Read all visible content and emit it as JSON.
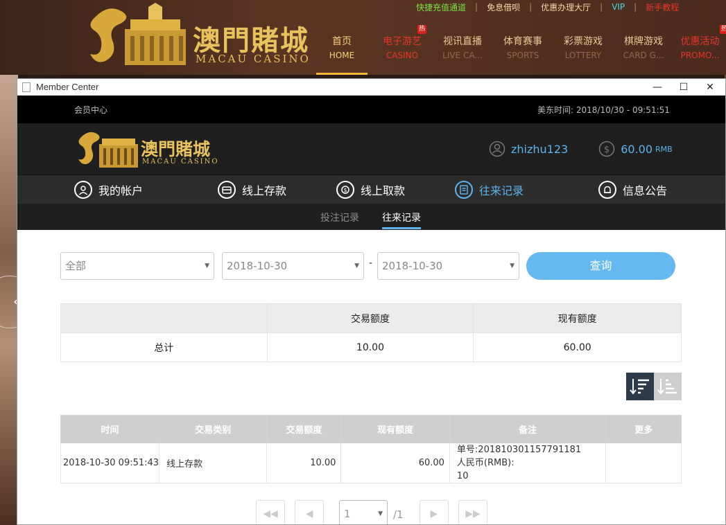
{
  "site": {
    "logo_cn": "澳門賭城",
    "logo_en": "MACAU CASINO",
    "top_links": [
      "快捷充值通道",
      "免息借呗",
      "优惠办理大厅",
      "VIP",
      "新手教程"
    ],
    "top_link_colors": [
      "#7de04a",
      "#f1d9a8",
      "#f1d9a8",
      "#4ad8e6",
      "#e8352a"
    ],
    "nav": [
      {
        "cn": "首页",
        "en": "HOME"
      },
      {
        "cn": "电子游艺",
        "en": "CASINO",
        "hot": "热"
      },
      {
        "cn": "视讯直播",
        "en": "LIVE CA..."
      },
      {
        "cn": "体育赛事",
        "en": "SPORTS"
      },
      {
        "cn": "彩票游戏",
        "en": "LOTTERY"
      },
      {
        "cn": "棋牌游戏",
        "en": "CARD G..."
      },
      {
        "cn": "优惠活动",
        "en": "PROMO...",
        "hot": "热"
      }
    ]
  },
  "window": {
    "title": "Member Center",
    "controls": {
      "minimize": "—",
      "maximize": "☐",
      "close": "✕"
    }
  },
  "member": {
    "center_label": "会员中心",
    "time_label": "美东时间:",
    "time_value": "2018/10/30 - 09:51:51",
    "logo_cn": "澳門賭城",
    "logo_en": "MACAU CASINO",
    "username": "zhizhu123",
    "balance": "60.00",
    "currency": "RMB",
    "nav": [
      {
        "label": "我的帐户",
        "icon": "user-icon"
      },
      {
        "label": "线上存款",
        "icon": "deposit-icon"
      },
      {
        "label": "线上取款",
        "icon": "withdraw-icon"
      },
      {
        "label": "往来记录",
        "icon": "records-icon"
      },
      {
        "label": "信息公告",
        "icon": "bell-icon"
      }
    ],
    "sub_tabs": [
      "投注记录",
      "往来记录"
    ]
  },
  "filters": {
    "type_value": "全部",
    "date_from": "2018-10-30",
    "date_to": "2018-10-30",
    "dash": "-",
    "query_label": "查询"
  },
  "summary": {
    "headers": [
      "",
      "交易额度",
      "现有额度"
    ],
    "row": [
      "总计",
      "10.00",
      "60.00"
    ]
  },
  "records": {
    "headers": [
      "时间",
      "交易类别",
      "交易额度",
      "现有额度",
      "备注",
      "更多"
    ],
    "rows": [
      {
        "time": "2018-10-30 09:51:43",
        "type": "线上存款",
        "amount": "10.00",
        "balance": "60.00",
        "note_line1": "单号:201810301157791181",
        "note_line2": "人民币(RMB):",
        "note_line3": "10",
        "more": ""
      }
    ]
  },
  "pager": {
    "first": "◀◀",
    "prev": "◀",
    "page": "1",
    "total": "/1",
    "next": "▶",
    "last": "▶▶"
  },
  "colors": {
    "accent": "#5bb4f0",
    "gold": "#e8c25c",
    "hot": "#d9221b"
  }
}
